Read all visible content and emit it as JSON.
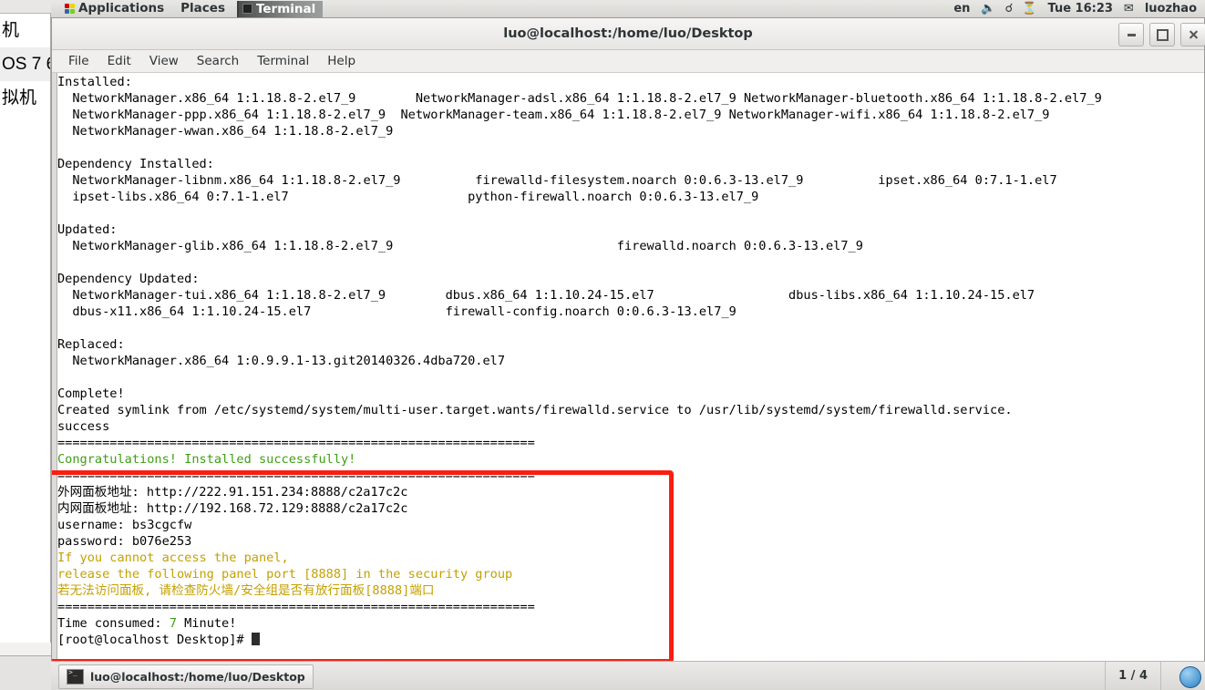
{
  "host_sidebar": {
    "tree_rows": [
      "机",
      "OS 7 6",
      "拟机"
    ],
    "expand_icon": "chevron-right-icon"
  },
  "top_panel": {
    "applications": "Applications",
    "places": "Places",
    "window_button": "Terminal",
    "keyboard_layout": "en",
    "volume_icon": "volume-icon",
    "bluetooth_icon": "bluetooth-icon",
    "network_icon": "network-icon",
    "clock": "Tue 16:23",
    "user_icon": "user-icon",
    "user": "luozhao"
  },
  "window": {
    "title": "luo@localhost:/home/luo/Desktop",
    "minimize": "minimize-icon",
    "maximize": "maximize-icon",
    "close": "close-icon",
    "menus": [
      "File",
      "Edit",
      "View",
      "Search",
      "Terminal",
      "Help"
    ]
  },
  "terminal": {
    "lines": [
      {
        "t": "Installed:"
      },
      {
        "t": "  NetworkManager.x86_64 1:1.18.8-2.el7_9        NetworkManager-adsl.x86_64 1:1.18.8-2.el7_9 NetworkManager-bluetooth.x86_64 1:1.18.8-2.el7_9"
      },
      {
        "t": "  NetworkManager-ppp.x86_64 1:1.18.8-2.el7_9  NetworkManager-team.x86_64 1:1.18.8-2.el7_9 NetworkManager-wifi.x86_64 1:1.18.8-2.el7_9"
      },
      {
        "t": "  NetworkManager-wwan.x86_64 1:1.18.8-2.el7_9"
      },
      {
        "t": ""
      },
      {
        "t": "Dependency Installed:"
      },
      {
        "t": "  NetworkManager-libnm.x86_64 1:1.18.8-2.el7_9          firewalld-filesystem.noarch 0:0.6.3-13.el7_9          ipset.x86_64 0:7.1-1.el7"
      },
      {
        "t": "  ipset-libs.x86_64 0:7.1-1.el7                        python-firewall.noarch 0:0.6.3-13.el7_9"
      },
      {
        "t": ""
      },
      {
        "t": "Updated:"
      },
      {
        "t": "  NetworkManager-glib.x86_64 1:1.18.8-2.el7_9                              firewalld.noarch 0:0.6.3-13.el7_9"
      },
      {
        "t": ""
      },
      {
        "t": "Dependency Updated:"
      },
      {
        "t": "  NetworkManager-tui.x86_64 1:1.18.8-2.el7_9        dbus.x86_64 1:1.10.24-15.el7                  dbus-libs.x86_64 1:1.10.24-15.el7"
      },
      {
        "t": "  dbus-x11.x86_64 1:1.10.24-15.el7                  firewall-config.noarch 0:0.6.3-13.el7_9"
      },
      {
        "t": ""
      },
      {
        "t": "Replaced:"
      },
      {
        "t": "  NetworkManager.x86_64 1:0.9.9.1-13.git20140326.4dba720.el7"
      },
      {
        "t": ""
      },
      {
        "t": "Complete!"
      },
      {
        "t": "Created symlink from /etc/systemd/system/multi-user.target.wants/firewalld.service to /usr/lib/systemd/system/firewalld.service."
      },
      {
        "t": "success"
      },
      {
        "t": "================================================================"
      },
      {
        "t": "Congratulations! Installed successfully!",
        "c": "green"
      },
      {
        "t": "================================================================"
      },
      {
        "t": "外网面板地址: http://222.91.151.234:8888/c2a17c2c"
      },
      {
        "t": "内网面板地址: http://192.168.72.129:8888/c2a17c2c"
      },
      {
        "t": "username: bs3cgcfw"
      },
      {
        "t": "password: b076e253"
      },
      {
        "t": "If you cannot access the panel,",
        "c": "gold"
      },
      {
        "t": "release the following panel port [8888] in the security group",
        "c": "gold"
      },
      {
        "t": "若无法访问面板, 请检查防火墙/安全组是否有放行面板[8888]端口",
        "c": "gold"
      },
      {
        "t": "================================================================"
      }
    ],
    "time_consumed_prefix": "Time consumed: ",
    "time_consumed_value": "7",
    "time_consumed_suffix": " Minute!",
    "prompt": "[root@localhost Desktop]# "
  },
  "annotation": {
    "box_color": "#fc1d11"
  },
  "taskbar": {
    "task_button": "luo@localhost:/home/luo/Desktop",
    "task_icon": "terminal-icon",
    "workspace": "1 / 4",
    "trash_icon": "trash-icon"
  }
}
